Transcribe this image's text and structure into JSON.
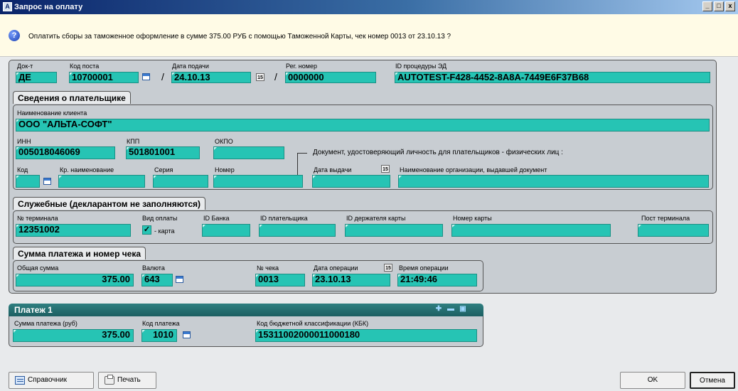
{
  "window": {
    "title": "Запрос на оплату",
    "controls": [
      "_",
      "□",
      "x"
    ]
  },
  "question": {
    "icon": "question-icon",
    "text": "Оплатить сборы за таможенное оформление в сумме 375.00 РУБ с помощью Таможенной Карты, чек номер 0013 от 23.10.13 ?"
  },
  "header": {
    "doc_type_label": "Док-т",
    "doc_type_value": "ДЕ",
    "post_code_label": "Код поста",
    "post_code_value": "10700001",
    "submit_date_label": "Дата подачи",
    "submit_date_value": "24.10.13",
    "reg_number_label": "Рег. номер",
    "reg_number_value": "0000000",
    "procedure_id_label": "ID процедуры ЭД",
    "procedure_id_value": "AUTOTEST-F428-4452-8A8A-7449E6F37B68",
    "slash": "/",
    "cal15": "15"
  },
  "payer": {
    "title": "Сведения о плательщике",
    "client_name_label": "Наименование клиента",
    "client_name_value": "ООО \"АЛЬТА-СОФТ\"",
    "inn_label": "ИНН",
    "inn_value": "005018046069",
    "kpp_label": "КПП",
    "kpp_value": "501801001",
    "okpo_label": "ОКПО",
    "okpo_value": "",
    "doc_caption": "Документ, удостоверяющий личность для плательщиков - физических лиц :",
    "code_label": "Код",
    "code_value": "",
    "short_name_label": "Кр. наименование",
    "short_name_value": "",
    "series_label": "Серия",
    "series_value": "",
    "number_label": "Номер",
    "number_value": "",
    "issue_date_label": "Дата выдачи",
    "issue_date_value": "",
    "issuer_label": "Наименование организации, выдавшей документ",
    "issuer_value": ""
  },
  "service": {
    "title": "Служебные (декларантом не заполняются)",
    "terminal_label": "№ терминала",
    "terminal_value": "12351002",
    "pay_type_label": "Вид оплаты",
    "pay_type_checked": "✓",
    "pay_type_text": "- карта",
    "bank_id_label": "ID Банка",
    "bank_id_value": "",
    "payer_id_label": "ID плательщика",
    "payer_id_value": "",
    "card_holder_label": "ID держателя карты",
    "card_holder_value": "",
    "card_number_label": "Номер карты",
    "card_number_value": "",
    "terminal_post_label": "Пост терминала",
    "terminal_post_value": ""
  },
  "sum": {
    "title": "Сумма платежа и номер чека",
    "total_label": "Общая сумма",
    "total_value": "375.00",
    "currency_label": "Валюта",
    "currency_value": "643",
    "check_label": "№ чека",
    "check_value": "0013",
    "op_date_label": "Дата операции",
    "op_date_value": "23.10.13",
    "op_time_label": "Время операции",
    "op_time_value": "21:49:46"
  },
  "payment": {
    "title": "Платеж 1",
    "tools": [
      "✚",
      "▬",
      "▣"
    ],
    "amount_label": "Сумма платежа (руб)",
    "amount_value": "375.00",
    "code_label": "Код платежа",
    "code_value": "1010",
    "kbk_label": "Код бюджетной классификации (КБК)",
    "kbk_value": "15311002000011000180"
  },
  "buttons": {
    "reference": "Справочник",
    "print": "Печать",
    "ok": "OK",
    "cancel": "Отмена"
  },
  "colors": {
    "field": "#26c4b4",
    "panel": "#c8cdd2",
    "background": "#e8eaec",
    "titlebar": "#0a246a",
    "question_bar": "#fffbe6"
  }
}
